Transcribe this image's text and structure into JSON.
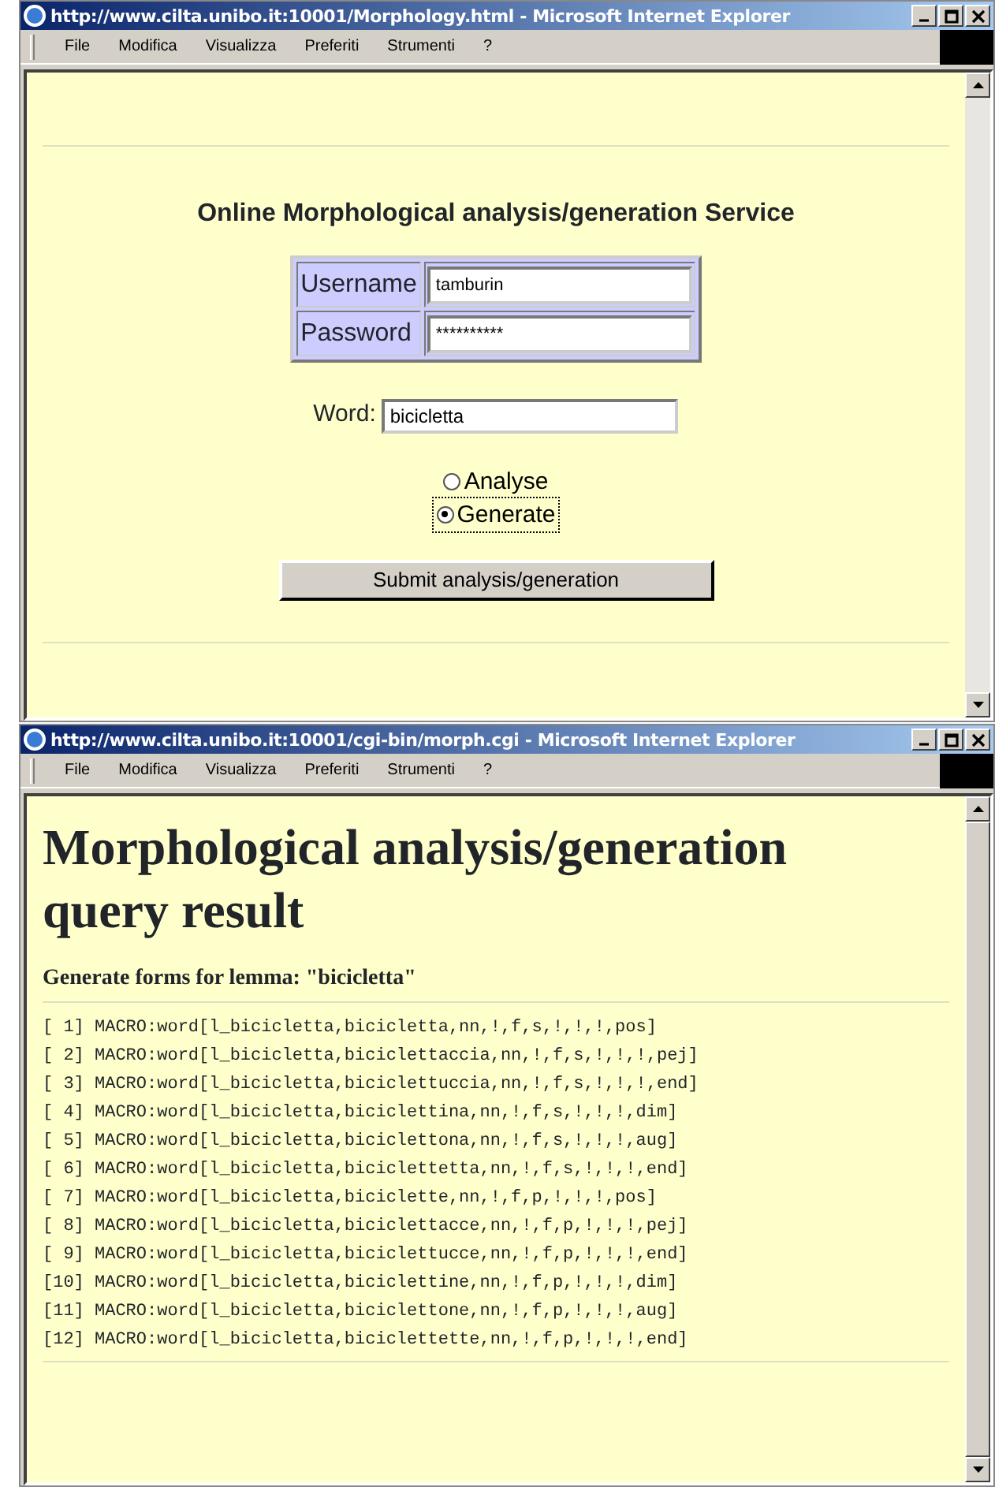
{
  "windows": [
    {
      "title": "http://www.cilta.unibo.it:10001/Morphology.html - Microsoft Internet Explorer",
      "menu": [
        "File",
        "Modifica",
        "Visualizza",
        "Preferiti",
        "Strumenti",
        "?"
      ],
      "kind": "form",
      "form": {
        "heading": "Online Morphological analysis/generation Service",
        "login": [
          {
            "label": "Username",
            "value": "tamburin"
          },
          {
            "label": "Password",
            "value": "**********"
          }
        ],
        "word": {
          "label": "Word:",
          "value": "bicicletta"
        },
        "options": [
          {
            "label": "Analyse",
            "selected": false
          },
          {
            "label": "Generate",
            "selected": true
          }
        ],
        "submit": "Submit analysis/generation"
      }
    },
    {
      "title": "http://www.cilta.unibo.it:10001/cgi-bin/morph.cgi - Microsoft Internet Explorer",
      "menu": [
        "File",
        "Modifica",
        "Visualizza",
        "Preferiti",
        "Strumenti",
        "?"
      ],
      "kind": "result",
      "result": {
        "heading": "Morphological analysis/generation query result",
        "subheading": "Generate forms for lemma: \"bicicletta\"",
        "lines": [
          "[ 1] MACRO:word[l_bicicletta,bicicletta,nn,!,f,s,!,!,!,pos]",
          "[ 2] MACRO:word[l_bicicletta,biciclettaccia,nn,!,f,s,!,!,!,pej]",
          "[ 3] MACRO:word[l_bicicletta,biciclettuccia,nn,!,f,s,!,!,!,end]",
          "[ 4] MACRO:word[l_bicicletta,biciclettina,nn,!,f,s,!,!,!,dim]",
          "[ 5] MACRO:word[l_bicicletta,biciclettona,nn,!,f,s,!,!,!,aug]",
          "[ 6] MACRO:word[l_bicicletta,biciclettetta,nn,!,f,s,!,!,!,end]",
          "[ 7] MACRO:word[l_bicicletta,biciclette,nn,!,f,p,!,!,!,pos]",
          "[ 8] MACRO:word[l_bicicletta,biciclettacce,nn,!,f,p,!,!,!,pej]",
          "[ 9] MACRO:word[l_bicicletta,biciclettucce,nn,!,f,p,!,!,!,end]",
          "[10] MACRO:word[l_bicicletta,biciclettine,nn,!,f,p,!,!,!,dim]",
          "[11] MACRO:word[l_bicicletta,biciclettone,nn,!,f,p,!,!,!,aug]",
          "[12] MACRO:word[l_bicicletta,biciclettette,nn,!,f,p,!,!,!,end]"
        ]
      }
    }
  ]
}
